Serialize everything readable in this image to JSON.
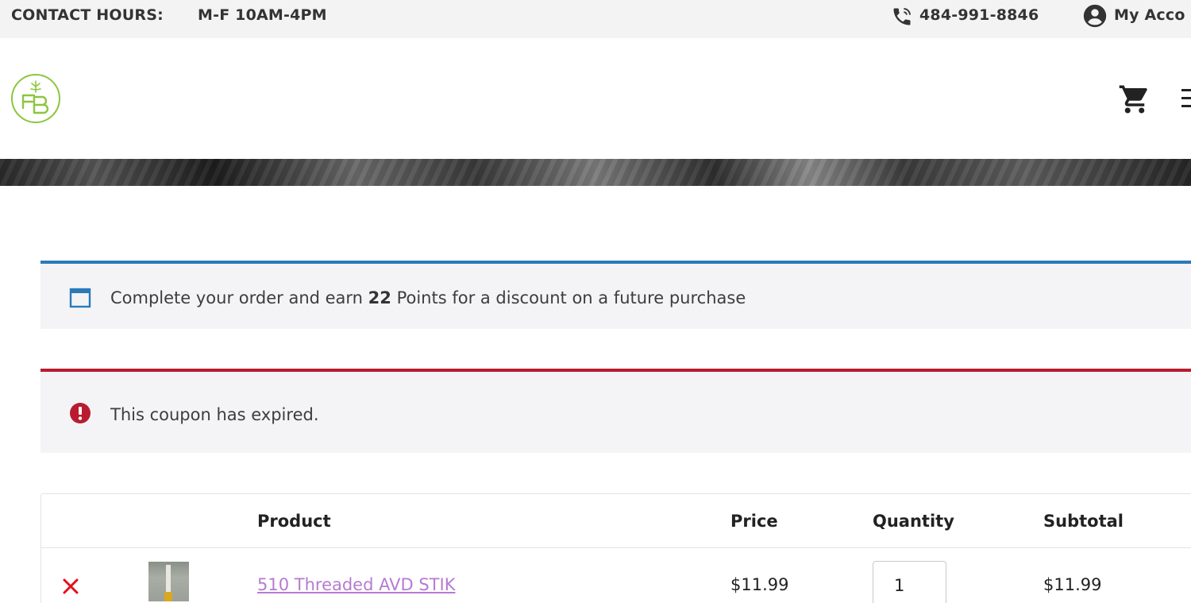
{
  "topbar": {
    "hours_label": "CONTACT HOURS:",
    "hours_value": "M-F 10AM-4PM",
    "phone": "484-991-8846",
    "account": "My Acco",
    "phone_icon": "phone-icon",
    "account_icon": "user-circle-icon"
  },
  "header": {
    "logo_icon": "hb-leaf-logo",
    "cart_icon": "cart-icon",
    "menu_icon": "hamburger-menu-icon"
  },
  "notices": {
    "info": {
      "text_before": "Complete your order and earn ",
      "points": "22",
      "text_after": " Points for a discount on a future purchase",
      "icon": "window-icon",
      "accent": "#2a7ab8"
    },
    "error": {
      "text": "This coupon has expired.",
      "icon": "exclamation-circle-icon",
      "accent": "#b81c2e"
    }
  },
  "cart": {
    "headers": {
      "product": "Product",
      "price": "Price",
      "quantity": "Quantity",
      "subtotal": "Subtotal"
    },
    "items": [
      {
        "name": "510 Threaded AVD STIK",
        "price": "$11.99",
        "quantity": "1",
        "subtotal": "$11.99"
      }
    ]
  },
  "colors": {
    "logo_green": "#8cc63f",
    "link": "#b77bd0",
    "remove_red": "#e3101a"
  }
}
